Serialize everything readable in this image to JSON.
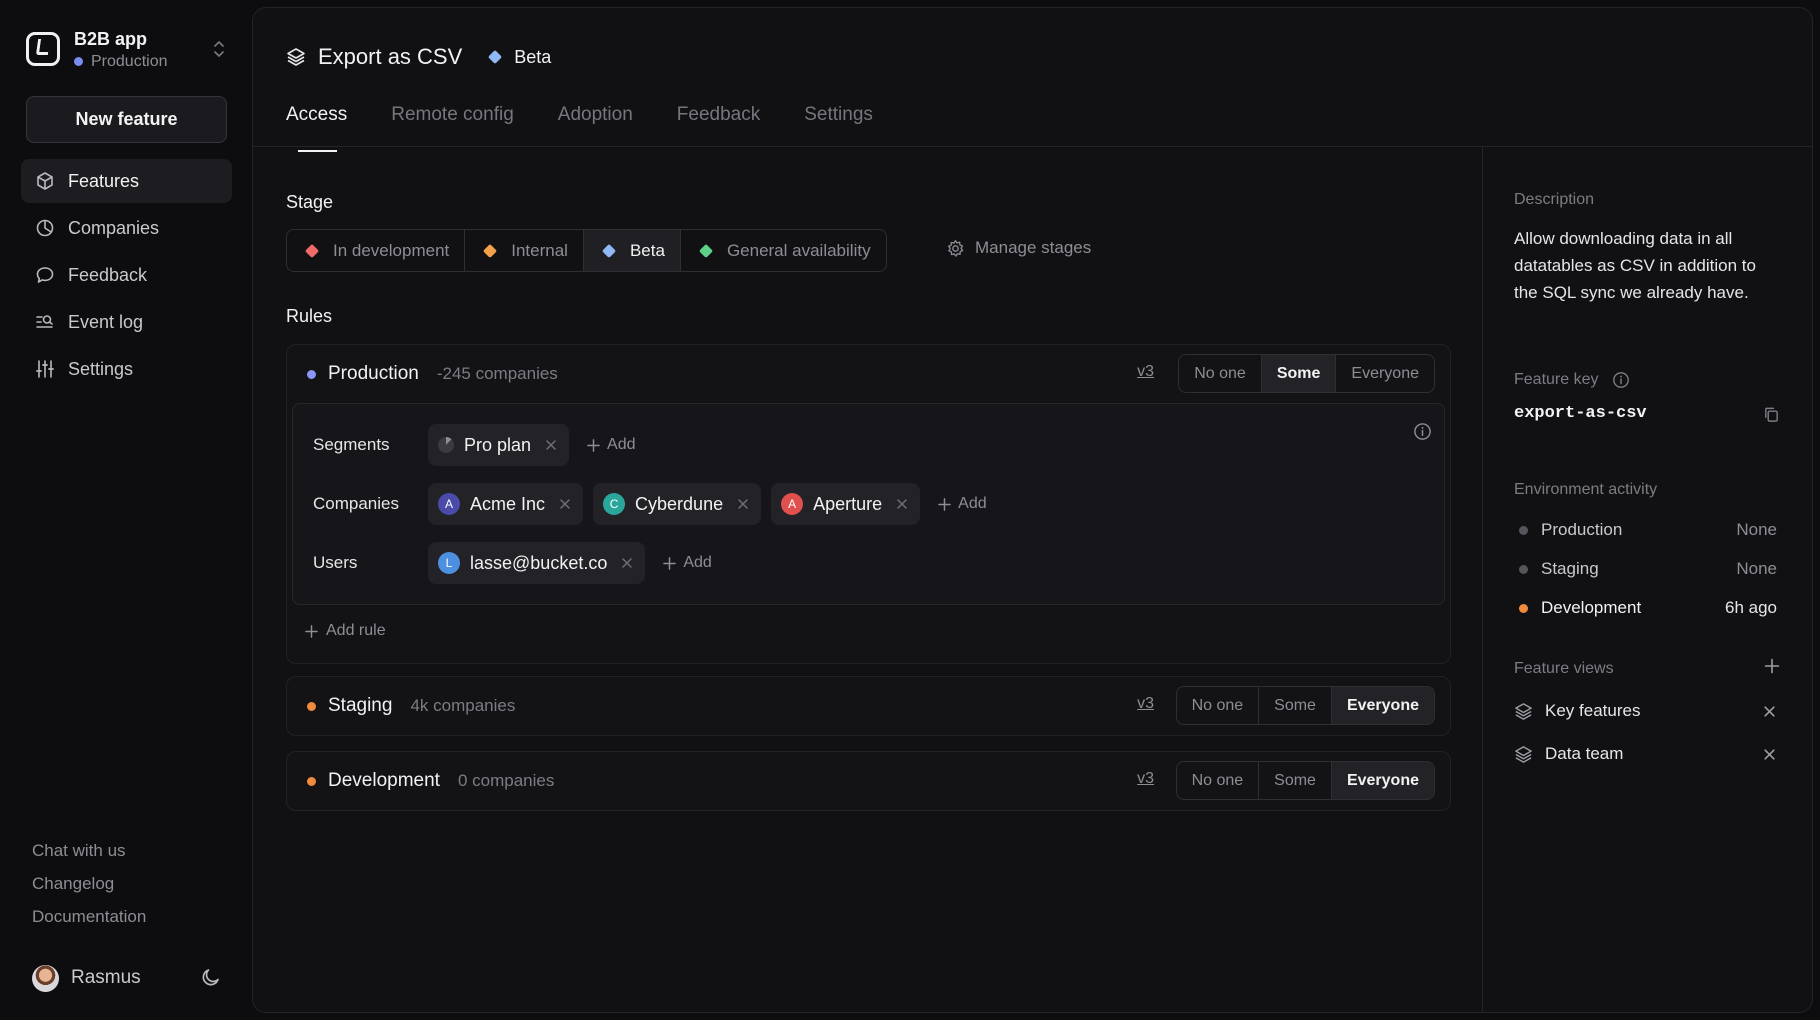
{
  "app": {
    "name": "B2B app",
    "environment": "Production",
    "environment_color": "#7b8cf0"
  },
  "sidebar": {
    "new_feature_label": "New feature",
    "items": [
      {
        "label": "Features",
        "icon": "cube-icon",
        "active": true
      },
      {
        "label": "Companies",
        "icon": "pie-chart-icon",
        "active": false
      },
      {
        "label": "Feedback",
        "icon": "chat-bubble-icon",
        "active": false
      },
      {
        "label": "Event log",
        "icon": "event-log-icon",
        "active": false
      },
      {
        "label": "Settings",
        "icon": "sliders-icon",
        "active": false
      }
    ],
    "footer_links": [
      "Chat with us",
      "Changelog",
      "Documentation"
    ],
    "user": {
      "name": "Rasmus"
    }
  },
  "header": {
    "title": "Export as CSV",
    "stage": "Beta",
    "stage_color": "#8fb8f5"
  },
  "tabs": [
    {
      "label": "Access",
      "active": true
    },
    {
      "label": "Remote config",
      "active": false
    },
    {
      "label": "Adoption",
      "active": false
    },
    {
      "label": "Feedback",
      "active": false
    },
    {
      "label": "Settings",
      "active": false
    }
  ],
  "stage_section": {
    "label": "Stage",
    "options": [
      {
        "label": "In development",
        "color": "#f06a6a",
        "active": false
      },
      {
        "label": "Internal",
        "color": "#f0a14a",
        "active": false
      },
      {
        "label": "Beta",
        "color": "#8fb8f5",
        "active": true
      },
      {
        "label": "General availability",
        "color": "#5fd08a",
        "active": false
      }
    ],
    "manage_label": "Manage stages"
  },
  "rules_section": {
    "label": "Rules",
    "environments": [
      {
        "name": "Production",
        "color": "#8a96f5",
        "count": "-245 companies",
        "version": "v3",
        "options": [
          "No one",
          "Some",
          "Everyone"
        ],
        "selected": "Some",
        "rules": {
          "segments_label": "Segments",
          "segments": [
            {
              "name": "Pro plan"
            }
          ],
          "companies_label": "Companies",
          "companies": [
            {
              "name": "Acme Inc",
              "initial": "A",
              "color": "#4b4aa8"
            },
            {
              "name": "Cyberdune",
              "initial": "C",
              "color": "#2aa79b"
            },
            {
              "name": "Aperture",
              "initial": "A",
              "color": "#e0504e"
            }
          ],
          "users_label": "Users",
          "users": [
            {
              "name": "lasse@bucket.co",
              "initial": "L",
              "color": "#4d8fe0"
            }
          ],
          "add_label": "Add"
        },
        "add_rule_label": "Add rule"
      },
      {
        "name": "Staging",
        "color": "#f08a3c",
        "count": "4k companies",
        "version": "v3",
        "options": [
          "No one",
          "Some",
          "Everyone"
        ],
        "selected": "Everyone"
      },
      {
        "name": "Development",
        "color": "#f08a3c",
        "count": "0 companies",
        "version": "v3",
        "options": [
          "No one",
          "Some",
          "Everyone"
        ],
        "selected": "Everyone"
      }
    ]
  },
  "details": {
    "description_label": "Description",
    "description": "Allow downloading data in all datatables as CSV in addition to the SQL sync we already have.",
    "feature_key_label": "Feature key",
    "feature_key": "export-as-csv",
    "activity_label": "Environment activity",
    "activity": [
      {
        "env": "Production",
        "value": "None",
        "color": "#55555c"
      },
      {
        "env": "Staging",
        "value": "None",
        "color": "#55555c"
      },
      {
        "env": "Development",
        "value": "6h ago",
        "color": "#f08a3c"
      }
    ],
    "views_label": "Feature views",
    "views": [
      "Key features",
      "Data team"
    ]
  }
}
